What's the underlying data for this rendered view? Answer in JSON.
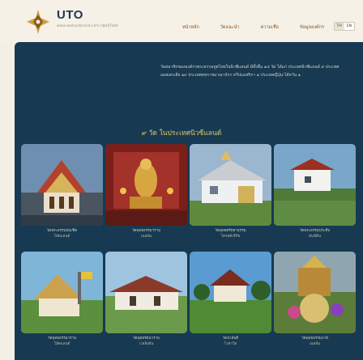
{
  "brand": {
    "name": "UTO",
    "tagline": "www.watsunbrand.com กลุ่มอุโบสถ"
  },
  "nav": [
    "หน้าหลัก",
    "วัดแนะนำ",
    "ความเชื่อ",
    "ข้อมูลองค์กร"
  ],
  "lang": [
    "TH",
    "EN"
  ],
  "intro": "วัดสมาชิกขององค์กรพระธรรมทูตไทยในนิวซีแลนด์ มีทั้งสิ้น ๑๔ วัด ได้แก่ ประเทศนิวซีแลนด์ ๙ ประเทศออสเตรเลีย ๑๓ ประเทศสหราชอาณาจักร ทวีปแอฟริกา ๑ ประเทศญี่ปุ่น-ไต้หวัน ๑",
  "section_title": "๙ วัด ในประเทศนิวซีแลนด์",
  "temples": [
    {
      "name": "วัดพระธรรมบัณฑิต",
      "city": "โอ๊คแลนด์"
    },
    {
      "name": "วัดพุทธธรรมาราม",
      "city": "เนลสัน"
    },
    {
      "name": "วัดพุทธศรัทธาธรรม",
      "city": "ไครสต์เชิร์ช"
    },
    {
      "name": "วัดพระธรรมประทีป",
      "city": "ดันนีดิน"
    },
    {
      "name": "วัดพุทธธรรมาราม",
      "city": "โอ๊คแลนด์"
    },
    {
      "name": "วัดพุทธรัตนาราม",
      "city": "เวลลิงตัน"
    },
    {
      "name": "วัดป่าสันติ",
      "city": "ไวคาโต"
    },
    {
      "name": "วัดพุทธธรรมบาลี",
      "city": "เนลสัน"
    }
  ],
  "colors": {
    "panel": "#173a52",
    "accent": "#e2c36a",
    "brand": "#1d3554"
  }
}
